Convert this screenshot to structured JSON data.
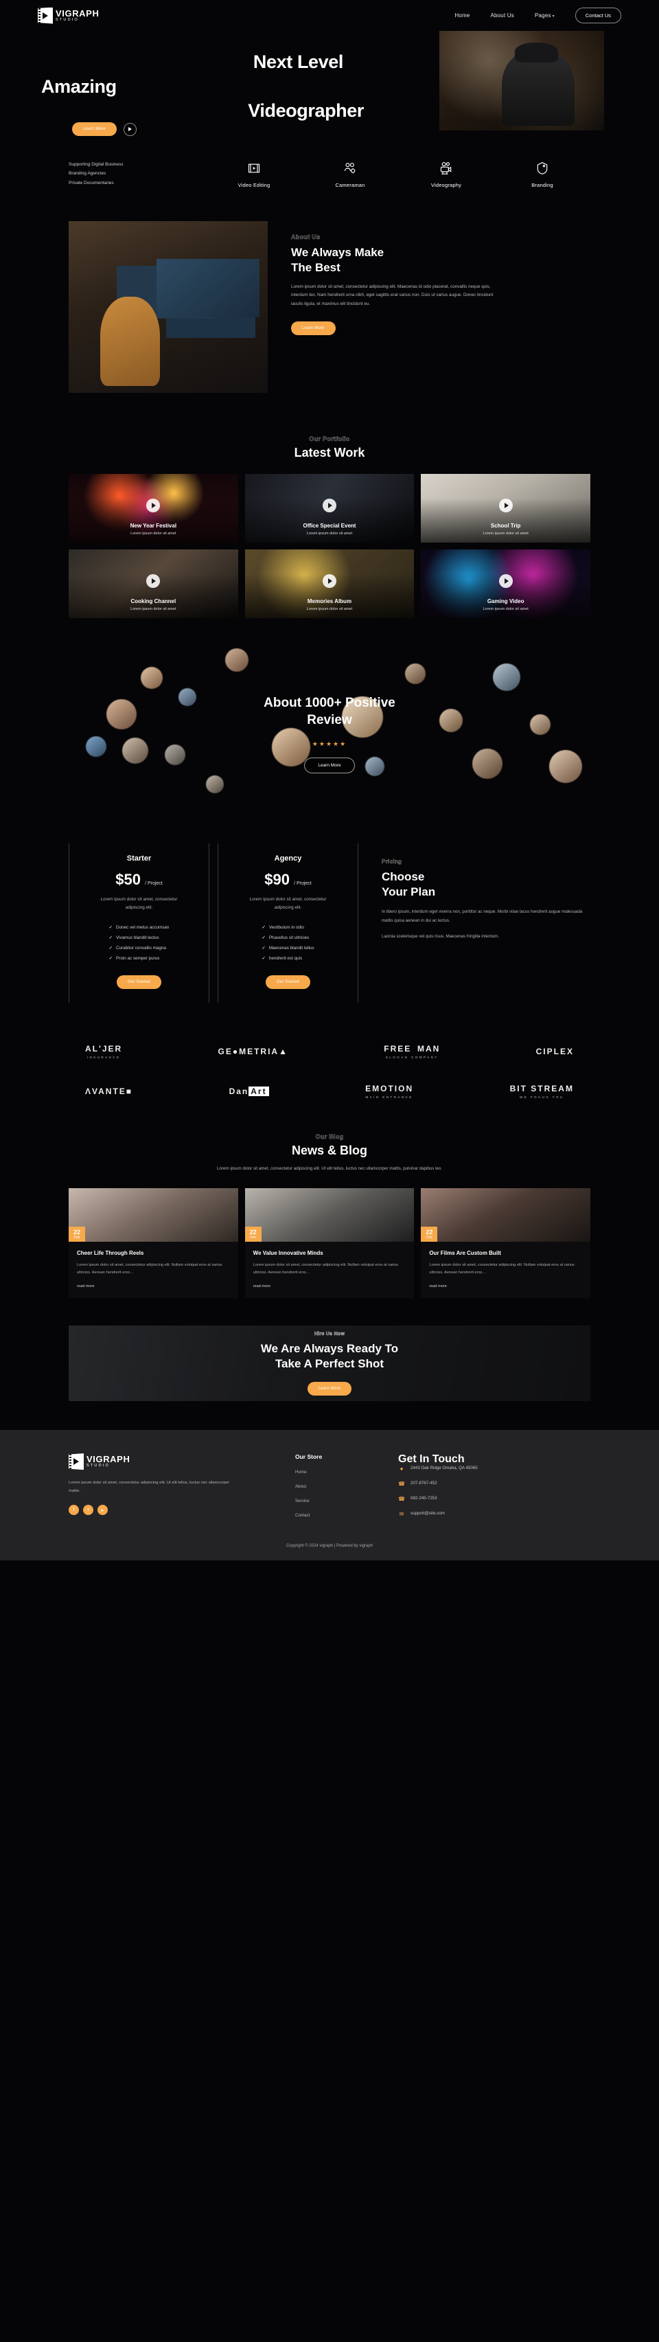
{
  "brand": {
    "name": "VIGRAPH",
    "sub": "STUDIO",
    "logo_icon": "film-play-icon"
  },
  "header": {
    "nav": [
      {
        "label": "Home"
      },
      {
        "label": "About Us"
      },
      {
        "label": "Pages",
        "caret": "▾"
      }
    ],
    "contact_label": "Contact Us"
  },
  "hero": {
    "line1": "Next Level",
    "line2": "Amazing",
    "line3": "Videographer",
    "cta_label": "Learn More",
    "play_icon": "play-icon"
  },
  "services": {
    "intro": [
      "Supporting Digital Business",
      "Branding Agencies",
      "Private Documentaries"
    ],
    "items": [
      {
        "label": "Video Editing",
        "icon": "film-strip-icon"
      },
      {
        "label": "Cameraman",
        "icon": "users-gear-icon"
      },
      {
        "label": "Videography",
        "icon": "movie-camera-icon"
      },
      {
        "label": "Branding",
        "icon": "tag-icon"
      }
    ]
  },
  "about": {
    "eyebrow": "About Us",
    "heading_l1": "We Always Make",
    "heading_l2": "The Best",
    "paragraph": "Lorem ipsum dolor sit amet, consectetur adipiscing elit. Maecenas id odio placerat, convallis neque quis, interdum leo. Nam hendrerit urna nibh, eget sagittis erat varius non. Duis ut varius augue. Donec tincidunt iaculis ligula, et maximus elit tincidunt eu.",
    "cta_label": "Learn More"
  },
  "portfolio": {
    "eyebrow": "Our Portfolio",
    "heading": "Latest Work",
    "items": [
      {
        "title": "New Year Festival",
        "subtitle": "Lorem ipsum dolor sit amet"
      },
      {
        "title": "Office Special Event",
        "subtitle": "Lorem ipsum dolor sit amet"
      },
      {
        "title": "School Trip",
        "subtitle": "Lorem ipsum dolor sit amet"
      },
      {
        "title": "Cooking Channel",
        "subtitle": "Lorem ipsum dolor sit amet"
      },
      {
        "title": "Memories Album",
        "subtitle": "Lorem ipsum dolor sit amet"
      },
      {
        "title": "Gaming Video",
        "subtitle": "Lorem ipsum dolor sit amet"
      }
    ]
  },
  "reviews": {
    "heading_l1": "About 1000+ Positive",
    "heading_l2": "Review",
    "stars": "★★★★★",
    "rating": 5,
    "cta_label": "Learn More"
  },
  "pricing": {
    "eyebrow": "Pricing",
    "heading_l1": "Choose",
    "heading_l2": "Your Plan",
    "paragraph1": "In libero ipsum, interdum eget viverra non, porttitor ac neque. Morbi vitae lacus hendrerit augue malesuada mattis quisa aenean in dui ac lectus.",
    "paragraph2": "Lacinia scelerisque vel quis risus. Maecenas fringilla interdum.",
    "plans": [
      {
        "name": "Starter",
        "price": "$50",
        "per": "/ Project",
        "desc": "Lorem ipsum dolor sit amet, consectetur adipiscing elit.",
        "features": [
          "Donec vel metus accumsan",
          "Vivamus blandit lectus",
          "Curabitur convallis magna",
          "Proin ac semper purus"
        ],
        "cta_label": "Get Started"
      },
      {
        "name": "Agency",
        "price": "$90",
        "per": "/ Project",
        "desc": "Lorem ipsum dolor sit amet, consectetur adipiscing elit.",
        "features": [
          "Vestibulum in odio",
          "Phasellus sit ultricies",
          "Maecenas blandit tellus",
          "hendrerit est quis"
        ],
        "cta_label": "Get Started"
      }
    ]
  },
  "brands": {
    "row1": [
      {
        "main": "AL'JER",
        "sub": "INSURANCE"
      },
      {
        "main": "GE●METRIA▲",
        "sub": ""
      },
      {
        "main": "FREE MAN",
        "sub": "SLOGAN COMPANY"
      },
      {
        "main": "CIPLEX",
        "sub": ""
      }
    ],
    "row2": [
      {
        "main": "ΛVANTE■",
        "sub": ""
      },
      {
        "main": "Dan",
        "accent": "Art",
        "sub": ""
      },
      {
        "main": "EMOTION",
        "sub": "MAIN ENTRANCE"
      },
      {
        "main": "BIT STREAM",
        "sub": "WE FOCUS YOU"
      }
    ]
  },
  "blog": {
    "eyebrow": "Our Blog",
    "heading": "News & Blog",
    "subtitle": "Lorem ipsum dolor sit amet, consectetur adipiscing elit. Ut elit tellus, luctus nec ullamcorper mattis, pulvinar dapibus leo.",
    "posts": [
      {
        "day": "22",
        "month": "Feb",
        "title": "Cheer Life Through Reels",
        "excerpt": "Lorem ipsum dolor sit amet, consectetur adipiscing elit. Nullam volutpat eros at varius ultricies. Aenean hendrerit eros…",
        "more": "read more"
      },
      {
        "day": "22",
        "month": "Feb",
        "title": "We Value Innovative Minds",
        "excerpt": "Lorem ipsum dolor sit amet, consectetur adipiscing elit. Nullam volutpat eros at varius ultricies. Aenean hendrerit eros…",
        "more": "read more"
      },
      {
        "day": "22",
        "month": "Feb",
        "title": "Our Films Are Custom Built",
        "excerpt": "Lorem ipsum dolor sit amet, consectetur adipiscing elit. Nullam volutpat eros at varius ultricies. Aenean hendrerit eros…",
        "more": "read more"
      }
    ]
  },
  "cta": {
    "eyebrow": "Hire Us Now",
    "heading_l1": "We Are Always Ready To",
    "heading_l2": "Take A Perfect Shot",
    "button_label": "Learn More"
  },
  "footer": {
    "about": "Lorem ipsum dolor sit amet, consectetur adipiscing elit. Ut elit tellus, luctus nec ullamcorper mattis.",
    "socials": [
      {
        "icon": "facebook-icon",
        "glyph": "f"
      },
      {
        "icon": "twitter-icon",
        "glyph": "ᴛ"
      },
      {
        "icon": "youtube-icon",
        "glyph": "▸"
      }
    ],
    "store": {
      "title": "Our Store",
      "links": [
        "Home",
        "About",
        "Service",
        "Contact"
      ]
    },
    "contact": {
      "title": "Get In Touch",
      "rows": [
        {
          "icon": "location-pin-icon",
          "glyph": "◉",
          "text": "2443 Oak Ridge Omaha, QA 45065"
        },
        {
          "icon": "phone-icon",
          "glyph": "☎",
          "text": "207-8767-452"
        },
        {
          "icon": "whatsapp-icon",
          "glyph": "☎",
          "text": "082-245-7253"
        },
        {
          "icon": "envelope-icon",
          "glyph": "✉",
          "text": "support@site.com"
        }
      ]
    },
    "copyright": "Copyright © 2024 vigraph | Powered by vigraph"
  },
  "colors": {
    "accent": "#f7a94b",
    "background": "#050507",
    "footer_bg": "#232325"
  }
}
